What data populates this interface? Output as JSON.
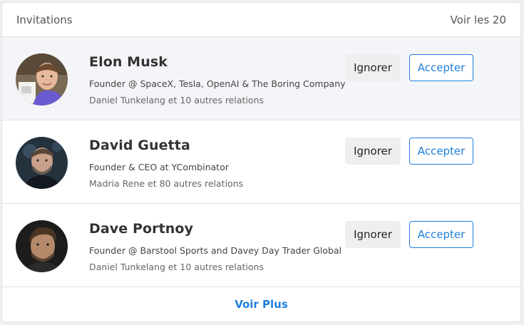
{
  "header": {
    "title": "Invitations",
    "see_all": "Voir les 20"
  },
  "invitations": [
    {
      "name": "Elon Musk",
      "headline": "Founder @ SpaceX, Tesla, OpenAI & The Boring Company",
      "mutual": "Daniel Tunkelang et 10 autres relations",
      "ignore_label": "Ignorer",
      "accept_label": "Accepter"
    },
    {
      "name": "David Guetta",
      "headline": "Founder & CEO at YCombinator",
      "mutual": "Madria Rene et 80 autres relations",
      "ignore_label": "Ignorer",
      "accept_label": "Accepter"
    },
    {
      "name": "Dave Portnoy",
      "headline": "Founder @ Barstool Sports and Davey Day Trader Global",
      "mutual": "Daniel Tunkelang et 10 autres relations",
      "ignore_label": "Ignorer",
      "accept_label": "Accepter"
    }
  ],
  "footer": {
    "more_label": "Voir Plus"
  },
  "colors": {
    "accent": "#1f7fdc",
    "highlight_row": "#f4f5f8",
    "ignore_bg": "#efefef"
  }
}
